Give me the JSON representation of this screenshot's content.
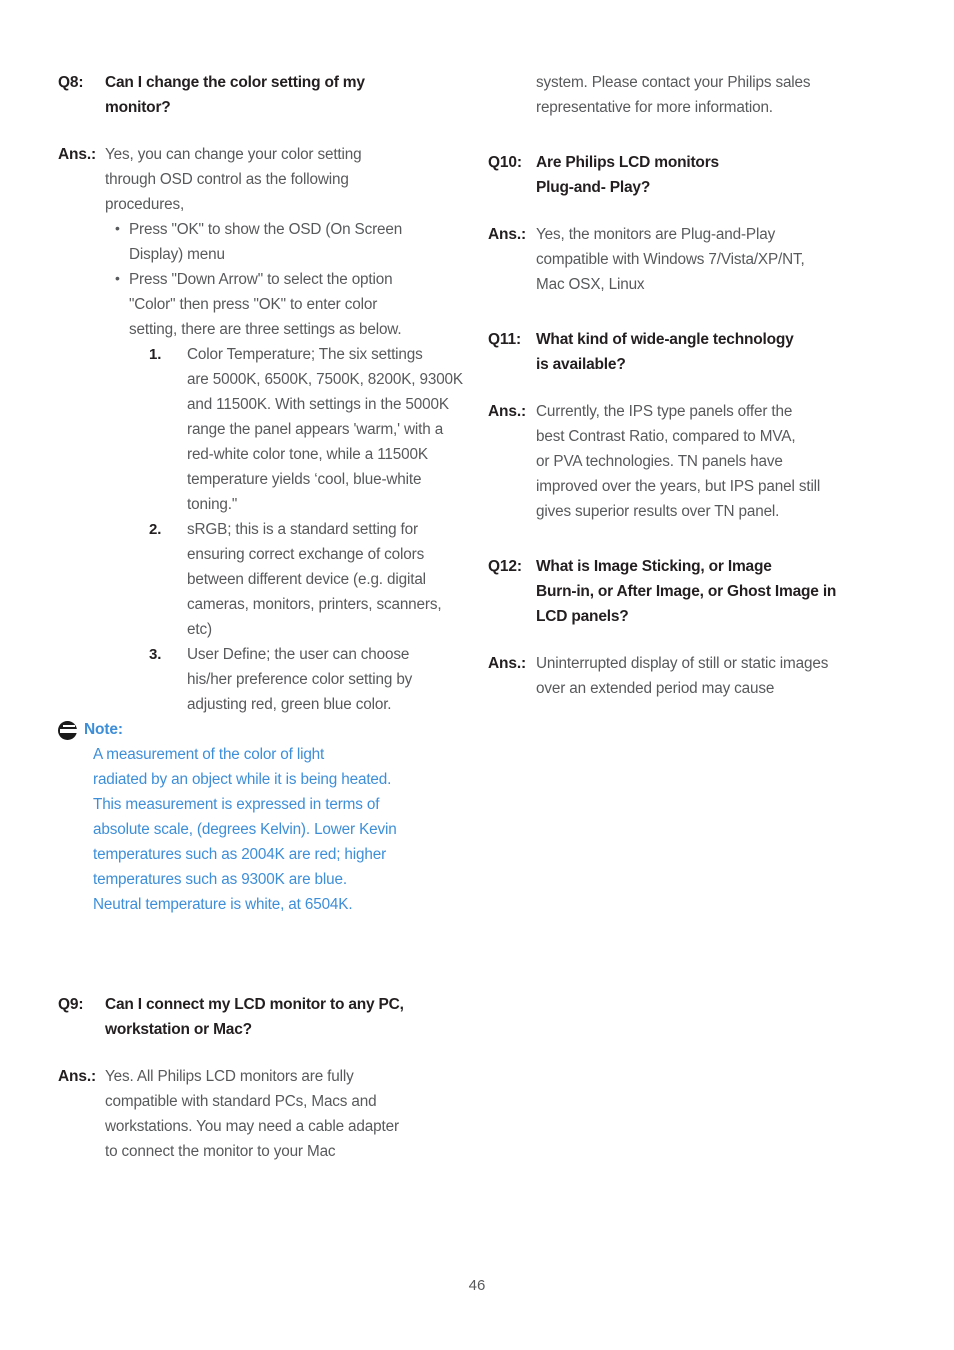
{
  "page": {
    "number": "46",
    "colors": {
      "heading": "#231f20",
      "body": "#58595b",
      "note_blue": "#3d8ed9",
      "background": "#ffffff"
    }
  },
  "left_column": {
    "q8": {
      "label": "Q8:",
      "question_lines": [
        "Can I change the color setting of my",
        "monitor?"
      ],
      "ans_label": "Ans.:",
      "answer_lines": [
        "Yes, you can change your color setting",
        "through OSD control as the following",
        "procedures,"
      ],
      "bullets": [
        [
          "Press \"OK\" to show the OSD (On Screen",
          "Display) menu"
        ],
        [
          "Press \"Down Arrow\" to select the option",
          "\"Color\" then press \"OK\" to enter color",
          "setting, there are three settings as below."
        ]
      ],
      "numbered": [
        {
          "num": "1.",
          "lines": [
            "Color Temperature; The six settings",
            "are 5000K, 6500K, 7500K, 8200K, 9300K",
            "and 11500K. With settings in the 5000K",
            "range the panel appears 'warm,' with a",
            "red-white color tone, while a 11500K",
            "temperature yields ‘cool, blue-white",
            "toning.\""
          ]
        },
        {
          "num": "2.",
          "lines": [
            "sRGB; this is a standard setting for",
            "ensuring correct exchange of colors",
            "between different device (e.g. digital",
            "cameras, monitors, printers, scanners,",
            "etc)"
          ]
        },
        {
          "num": "3.",
          "lines": [
            "User Define; the user can choose",
            "his/her preference color setting by",
            "adjusting red, green blue color."
          ]
        }
      ]
    },
    "note": {
      "icon": "note-icon",
      "title": "Note:",
      "lines": [
        "A measurement of the color of light",
        "radiated by an object while it is being heated.",
        "This measurement is expressed in terms of",
        "absolute scale, (degrees Kelvin). Lower Kevin",
        "temperatures such as 2004K are red; higher",
        "temperatures such as 9300K are blue.",
        "Neutral temperature is white, at 6504K."
      ]
    },
    "q9": {
      "label": "Q9:",
      "question_lines": [
        "Can I connect my LCD monitor to any PC,",
        "workstation or Mac?"
      ],
      "ans_label": "Ans.:",
      "answer_lines": [
        "Yes. All Philips LCD monitors are fully",
        "compatible with standard PCs, Macs and",
        "workstations. You may need a cable adapter",
        "to connect the monitor to your Mac"
      ]
    }
  },
  "right_column": {
    "continuation": {
      "lines": [
        "system. Please contact your Philips sales",
        "representative for more information."
      ]
    },
    "q10": {
      "label": "Q10:",
      "question_lines": [
        "Are Philips LCD monitors",
        "Plug-and- Play?"
      ],
      "ans_label": "Ans.:",
      "answer_lines": [
        "Yes, the monitors are Plug-and-Play",
        "compatible with Windows 7/Vista/XP/NT,",
        "Mac OSX, Linux"
      ]
    },
    "q11": {
      "label": "Q11:",
      "question_lines": [
        "What kind of wide-angle technology",
        "is available?"
      ],
      "ans_label": "Ans.:",
      "answer_lines": [
        "Currently, the IPS type panels offer the",
        "best Contrast Ratio, compared to MVA,",
        "or PVA technologies.  TN panels have",
        "improved over the years, but IPS panel still",
        "gives superior results over TN panel."
      ]
    },
    "q12": {
      "label": "Q12:",
      "question_lines": [
        "What is Image Sticking, or Image",
        "Burn-in, or After Image, or Ghost Image in",
        "LCD panels?"
      ],
      "ans_label": "Ans.:",
      "answer_lines": [
        "Uninterrupted display of still or static images",
        "over an extended period may cause"
      ]
    }
  }
}
